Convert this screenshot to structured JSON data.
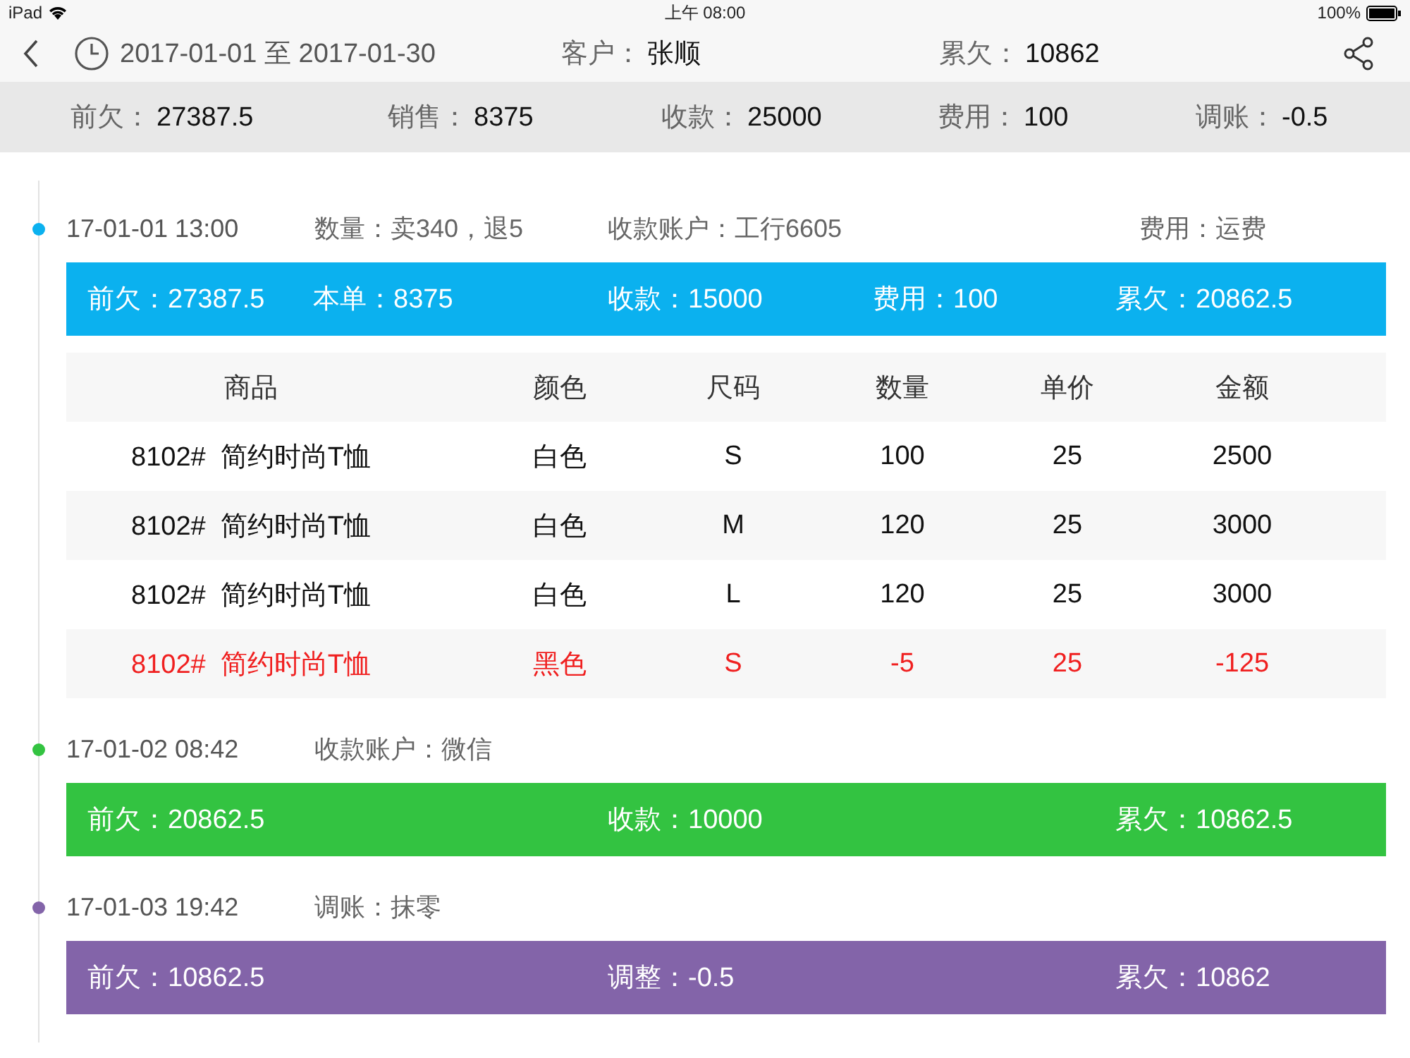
{
  "status_bar": {
    "device": "iPad",
    "time": "上午 08:00",
    "battery": "100%"
  },
  "header": {
    "date_range": "2017-01-01 至 2017-01-30",
    "customer": {
      "label": "客户：",
      "value": "张顺"
    },
    "total_debt": {
      "label": "累欠：",
      "value": "10862"
    }
  },
  "summary": [
    {
      "label": "前欠：",
      "value": "27387.5"
    },
    {
      "label": "销售：",
      "value": "8375"
    },
    {
      "label": "收款：",
      "value": "25000"
    },
    {
      "label": "费用：",
      "value": "100"
    },
    {
      "label": "调账：",
      "value": "-0.5"
    }
  ],
  "entries": [
    {
      "time": "17-01-01 13:00",
      "color": "#0bb1ef",
      "info": [
        "数量：卖340，退5",
        "收款账户：工行6605",
        "费用：运费"
      ],
      "totals": [
        "前欠：27387.5",
        "本单：8375",
        "收款：15000",
        "费用：100",
        "累欠：20862.5"
      ],
      "table": {
        "columns": [
          "商品",
          "颜色",
          "尺码",
          "数量",
          "单价",
          "金额"
        ],
        "rows": [
          {
            "returned": false,
            "cells": [
              "8102#  简约时尚T恤",
              "白色",
              "S",
              "100",
              "25",
              "2500"
            ]
          },
          {
            "returned": false,
            "cells": [
              "8102#  简约时尚T恤",
              "白色",
              "M",
              "120",
              "25",
              "3000"
            ]
          },
          {
            "returned": false,
            "cells": [
              "8102#  简约时尚T恤",
              "白色",
              "L",
              "120",
              "25",
              "3000"
            ]
          },
          {
            "returned": true,
            "cells": [
              "8102#  简约时尚T恤",
              "黑色",
              "S",
              "-5",
              "25",
              "-125"
            ]
          }
        ]
      }
    },
    {
      "time": "17-01-02 08:42",
      "color": "#33c341",
      "info": [
        "收款账户：微信"
      ],
      "totals": [
        "前欠：20862.5",
        "收款：10000",
        "累欠：10862.5"
      ]
    },
    {
      "time": "17-01-03 19:42",
      "color": "#8364a9",
      "info": [
        "调账：抹零"
      ],
      "totals": [
        "前欠：10862.5",
        "调整：-0.5",
        "累欠：10862"
      ]
    }
  ]
}
